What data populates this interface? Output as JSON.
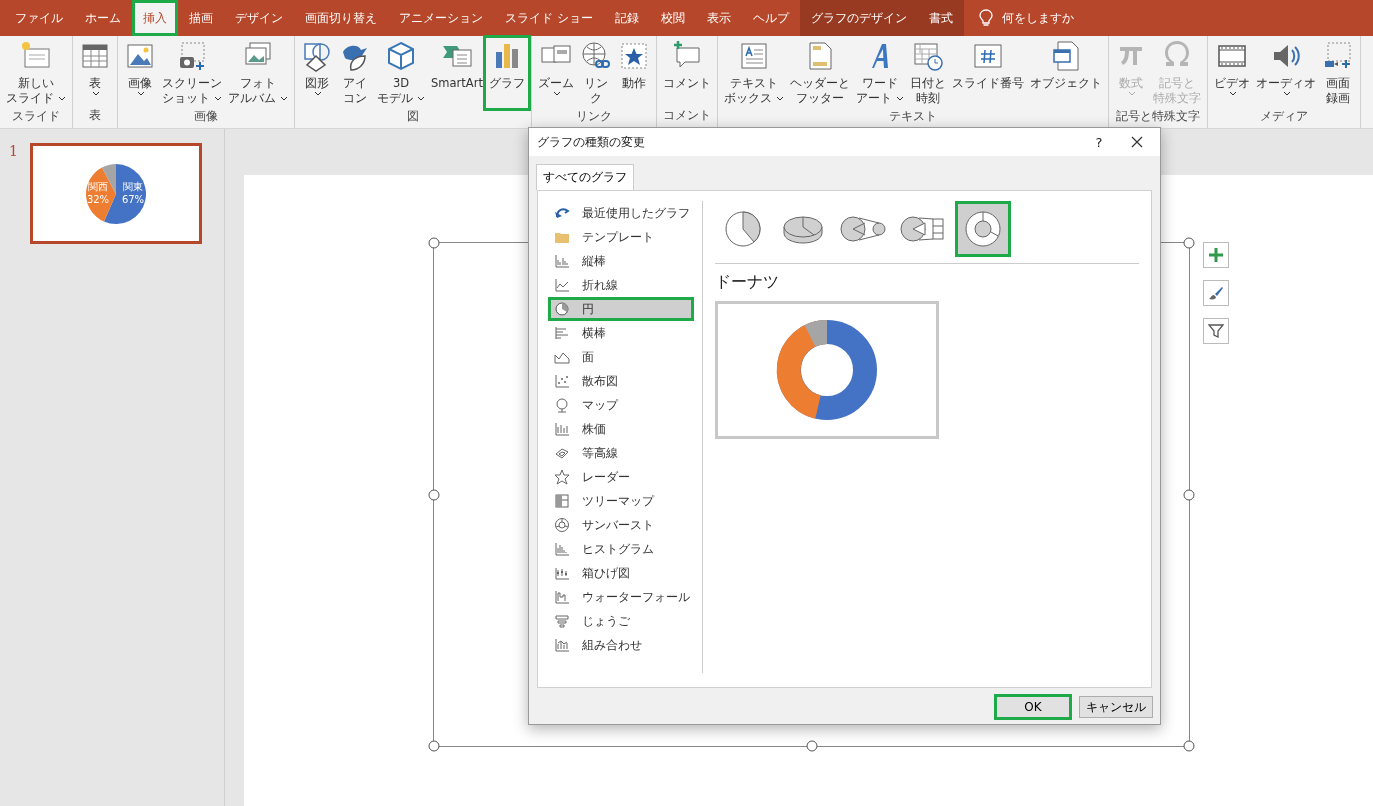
{
  "menu_tabs": [
    {
      "label": "ファイル",
      "selected": false,
      "highlighted": false,
      "contextual": false
    },
    {
      "label": "ホーム",
      "selected": false,
      "highlighted": false,
      "contextual": false
    },
    {
      "label": "挿入",
      "selected": true,
      "highlighted": true,
      "contextual": false
    },
    {
      "label": "描画",
      "selected": false,
      "highlighted": false,
      "contextual": false
    },
    {
      "label": "デザイン",
      "selected": false,
      "highlighted": false,
      "contextual": false
    },
    {
      "label": "画面切り替え",
      "selected": false,
      "highlighted": false,
      "contextual": false
    },
    {
      "label": "アニメーション",
      "selected": false,
      "highlighted": false,
      "contextual": false
    },
    {
      "label": "スライド ショー",
      "selected": false,
      "highlighted": false,
      "contextual": false
    },
    {
      "label": "記録",
      "selected": false,
      "highlighted": false,
      "contextual": false
    },
    {
      "label": "校閲",
      "selected": false,
      "highlighted": false,
      "contextual": false
    },
    {
      "label": "表示",
      "selected": false,
      "highlighted": false,
      "contextual": false
    },
    {
      "label": "ヘルプ",
      "selected": false,
      "highlighted": false,
      "contextual": false
    },
    {
      "label": "グラフのデザイン",
      "selected": false,
      "highlighted": false,
      "contextual": true
    },
    {
      "label": "書式",
      "selected": false,
      "highlighted": false,
      "contextual": true
    }
  ],
  "tell_me": {
    "label": "何をしますか"
  },
  "ribbon_groups": [
    {
      "label": "スライド",
      "items": [
        {
          "lines": [
            "新しい",
            "スライド"
          ],
          "dropdown": true,
          "disabled": false,
          "highlighted": false
        }
      ]
    },
    {
      "label": "表",
      "items": [
        {
          "lines": [
            "表"
          ],
          "dropdown": true,
          "disabled": false,
          "highlighted": false
        }
      ]
    },
    {
      "label": "画像",
      "items": [
        {
          "lines": [
            "画像"
          ],
          "dropdown": true,
          "disabled": false,
          "highlighted": false
        },
        {
          "lines": [
            "スクリーン",
            "ショット"
          ],
          "dropdown": true,
          "disabled": false,
          "highlighted": false
        },
        {
          "lines": [
            "フォト",
            "アルバム"
          ],
          "dropdown": true,
          "disabled": false,
          "highlighted": false
        }
      ]
    },
    {
      "label": "図",
      "items": [
        {
          "lines": [
            "図形"
          ],
          "dropdown": true,
          "disabled": false,
          "highlighted": false
        },
        {
          "lines": [
            "アイ",
            "コン"
          ],
          "dropdown": false,
          "disabled": false,
          "highlighted": false
        },
        {
          "lines": [
            "3D",
            "モデル"
          ],
          "dropdown": true,
          "disabled": false,
          "highlighted": false
        },
        {
          "lines": [
            "SmartArt"
          ],
          "dropdown": false,
          "disabled": false,
          "highlighted": false
        },
        {
          "lines": [
            "グラフ"
          ],
          "dropdown": false,
          "disabled": false,
          "highlighted": true
        }
      ]
    },
    {
      "label": "リンク",
      "items": [
        {
          "lines": [
            "ズーム"
          ],
          "dropdown": true,
          "disabled": false,
          "highlighted": false
        },
        {
          "lines": [
            "リン",
            "ク"
          ],
          "dropdown": false,
          "disabled": false,
          "highlighted": false
        },
        {
          "lines": [
            "動作"
          ],
          "dropdown": false,
          "disabled": false,
          "highlighted": false
        }
      ]
    },
    {
      "label": "コメント",
      "items": [
        {
          "lines": [
            "コメント"
          ],
          "dropdown": false,
          "disabled": false,
          "highlighted": false
        }
      ]
    },
    {
      "label": "テキスト",
      "items": [
        {
          "lines": [
            "テキスト",
            "ボックス"
          ],
          "dropdown": true,
          "disabled": false,
          "highlighted": false
        },
        {
          "lines": [
            "ヘッダーと",
            "フッター"
          ],
          "dropdown": false,
          "disabled": false,
          "highlighted": false
        },
        {
          "lines": [
            "ワード",
            "アート"
          ],
          "dropdown": true,
          "disabled": false,
          "highlighted": false
        },
        {
          "lines": [
            "日付と",
            "時刻"
          ],
          "dropdown": false,
          "disabled": false,
          "highlighted": false
        },
        {
          "lines": [
            "スライド番号"
          ],
          "dropdown": false,
          "disabled": false,
          "highlighted": false
        },
        {
          "lines": [
            "オブジェクト"
          ],
          "dropdown": false,
          "disabled": false,
          "highlighted": false
        }
      ]
    },
    {
      "label": "記号と特殊文字",
      "items": [
        {
          "lines": [
            "数式"
          ],
          "dropdown": true,
          "disabled": true,
          "highlighted": false
        },
        {
          "lines": [
            "記号と",
            "特殊文字"
          ],
          "dropdown": false,
          "disabled": true,
          "highlighted": false
        }
      ]
    },
    {
      "label": "メディア",
      "items": [
        {
          "lines": [
            "ビデオ"
          ],
          "dropdown": true,
          "disabled": false,
          "highlighted": false
        },
        {
          "lines": [
            "オーディオ"
          ],
          "dropdown": true,
          "disabled": false,
          "highlighted": false
        },
        {
          "lines": [
            "画面",
            "録画"
          ],
          "dropdown": false,
          "disabled": false,
          "highlighted": false
        }
      ]
    }
  ],
  "slide_panel": {
    "number": "1",
    "selected": true,
    "thumbnail_labels": [
      {
        "name": "関西",
        "percent": "32%"
      },
      {
        "name": "関東",
        "percent": "67%"
      }
    ]
  },
  "dialog": {
    "title": "グラフの種類の変更",
    "help": "?",
    "tabs": [
      {
        "label": "すべてのグラフ",
        "selected": true
      }
    ],
    "categories": [
      {
        "label": "最近使用したグラフ",
        "selected": false,
        "highlighted": false
      },
      {
        "label": "テンプレート",
        "selected": false,
        "highlighted": false
      },
      {
        "label": "縦棒",
        "selected": false,
        "highlighted": false
      },
      {
        "label": "折れ線",
        "selected": false,
        "highlighted": false
      },
      {
        "label": "円",
        "selected": true,
        "highlighted": true
      },
      {
        "label": "横棒",
        "selected": false,
        "highlighted": false
      },
      {
        "label": "面",
        "selected": false,
        "highlighted": false
      },
      {
        "label": "散布図",
        "selected": false,
        "highlighted": false
      },
      {
        "label": "マップ",
        "selected": false,
        "highlighted": false
      },
      {
        "label": "株価",
        "selected": false,
        "highlighted": false
      },
      {
        "label": "等高線",
        "selected": false,
        "highlighted": false
      },
      {
        "label": "レーダー",
        "selected": false,
        "highlighted": false
      },
      {
        "label": "ツリーマップ",
        "selected": false,
        "highlighted": false
      },
      {
        "label": "サンバースト",
        "selected": false,
        "highlighted": false
      },
      {
        "label": "ヒストグラム",
        "selected": false,
        "highlighted": false
      },
      {
        "label": "箱ひげ図",
        "selected": false,
        "highlighted": false
      },
      {
        "label": "ウォーターフォール",
        "selected": false,
        "highlighted": false
      },
      {
        "label": "じょうご",
        "selected": false,
        "highlighted": false
      },
      {
        "label": "組み合わせ",
        "selected": false,
        "highlighted": false
      }
    ],
    "subtypes": [
      {
        "selected": false,
        "highlighted": false
      },
      {
        "selected": false,
        "highlighted": false
      },
      {
        "selected": false,
        "highlighted": false
      },
      {
        "selected": false,
        "highlighted": false
      },
      {
        "selected": true,
        "highlighted": true
      }
    ],
    "subtype_title": "ドーナツ",
    "buttons": [
      {
        "label": "OK",
        "highlighted": true
      },
      {
        "label": "キャンセル",
        "highlighted": false
      }
    ]
  }
}
